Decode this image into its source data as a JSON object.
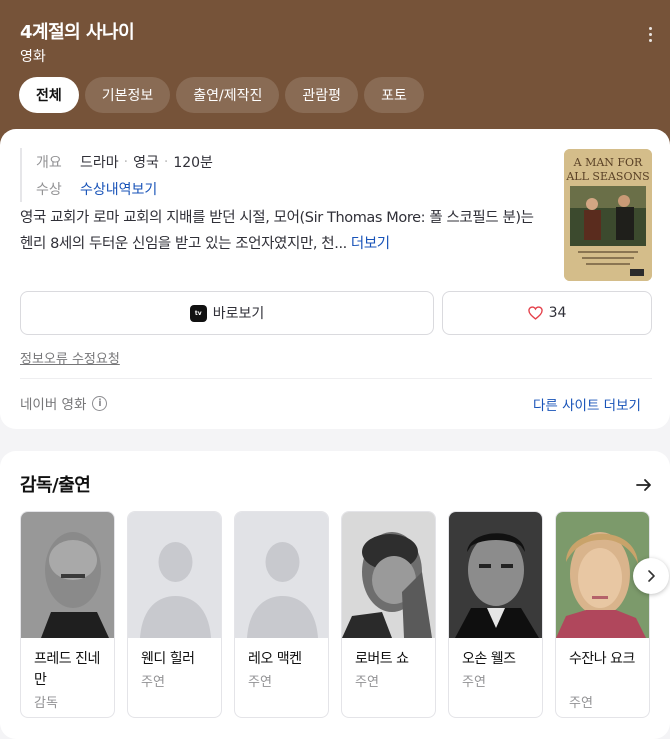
{
  "header": {
    "title": "4계절의 사나이",
    "subtitle": "영화",
    "tabs": [
      {
        "label": "전체",
        "active": true
      },
      {
        "label": "기본정보",
        "active": false
      },
      {
        "label": "출연/제작진",
        "active": false
      },
      {
        "label": "관람평",
        "active": false
      },
      {
        "label": "포토",
        "active": false
      }
    ]
  },
  "info": {
    "overview_label": "개요",
    "genre": "드라마",
    "country": "영국",
    "runtime": "120분",
    "award_label": "수상",
    "award_link": "수상내역보기",
    "synopsis": "영국 교회가 로마 교회의 지배를 받던 시절, 모어(Sir Thomas More: 폴 스코필드 분)는 헨리 8세의 두터운 신임을 받고 있는 조언자였지만, 천...",
    "more_label": "더보기",
    "watch_label": "바로보기",
    "watch_icon": "appletv-icon",
    "like_count": "34",
    "report_label": "정보오류 수정요청",
    "source_label": "네이버 영화",
    "more_sites_label": "다른 사이트 더보기",
    "poster_title": "A MAN FOR ALL SEASONS"
  },
  "cast": {
    "title": "감독/출연",
    "members": [
      {
        "name": "프레드 진네만",
        "role": "감독",
        "photo": "photo"
      },
      {
        "name": "웬디 힐러",
        "role": "주연",
        "photo": "placeholder"
      },
      {
        "name": "레오 맥켄",
        "role": "주연",
        "photo": "placeholder"
      },
      {
        "name": "로버트 쇼",
        "role": "주연",
        "photo": "photo"
      },
      {
        "name": "오손 웰즈",
        "role": "주연",
        "photo": "photo"
      },
      {
        "name": "수잔나 요크",
        "role": "주연",
        "photo": "photo"
      }
    ]
  },
  "colors": {
    "header_bg": "#765339",
    "link": "#1853b8",
    "heart": "#e4414b"
  }
}
